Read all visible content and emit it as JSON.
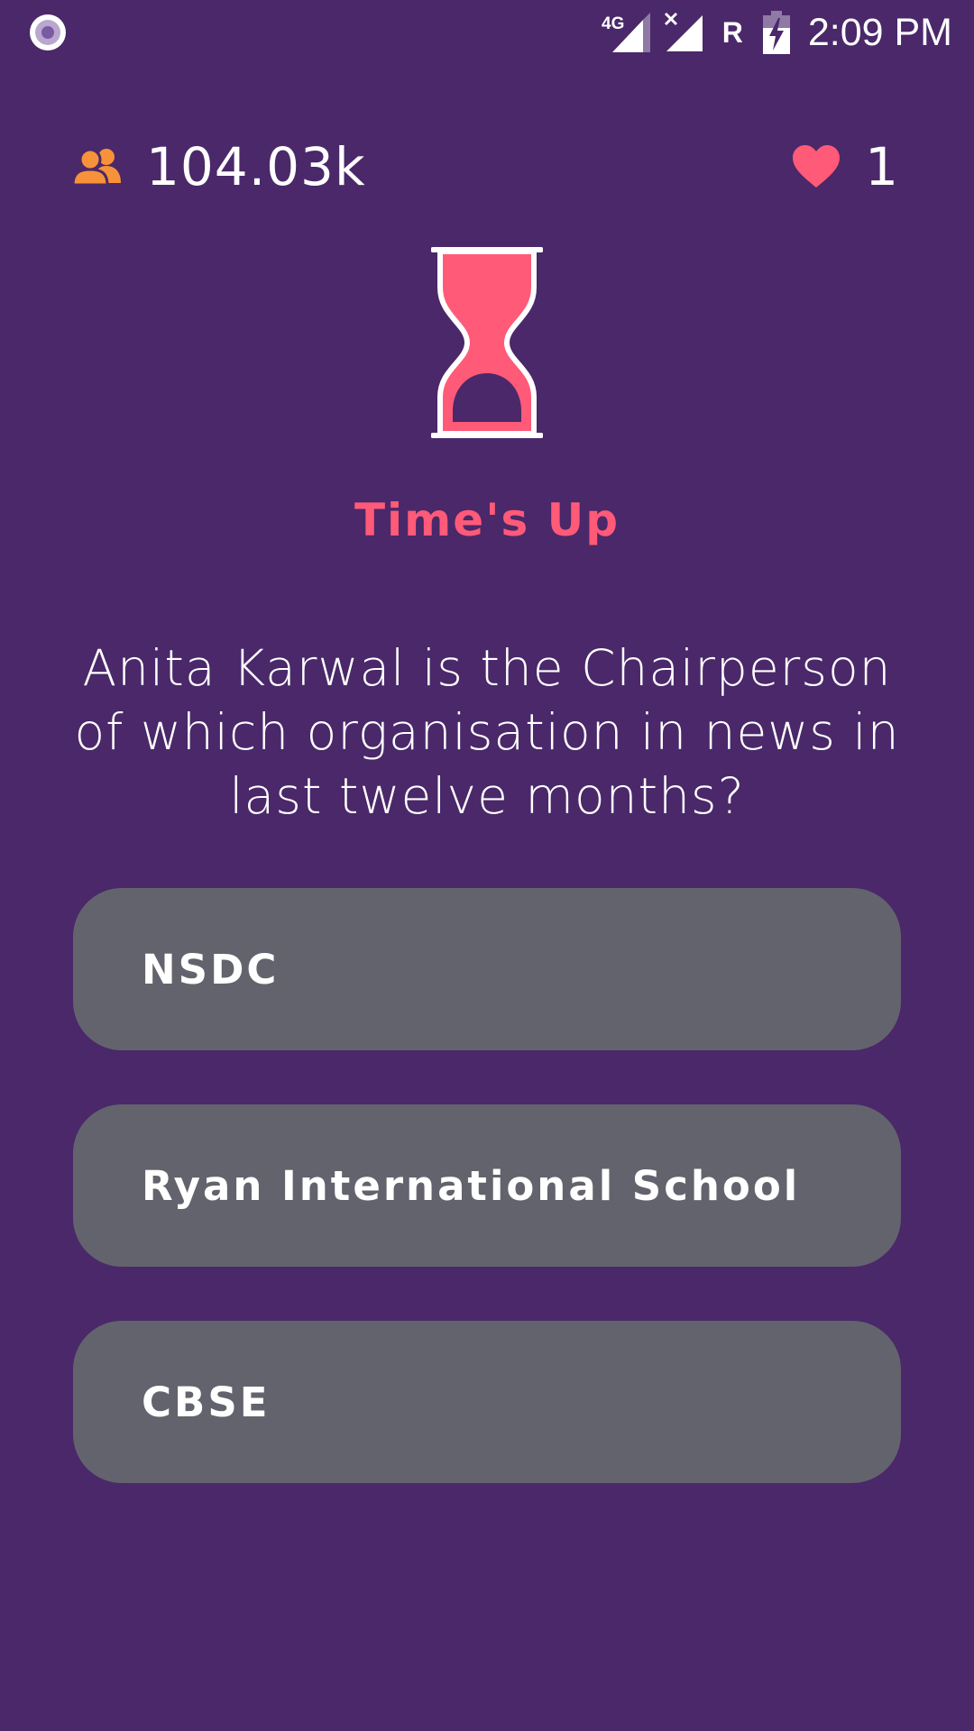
{
  "status_bar": {
    "network_type": "4G",
    "roaming_indicator": "R",
    "time": "2:09 PM",
    "icons": [
      "screen-record-icon",
      "signal-4g-icon",
      "signal-no-service-icon",
      "roaming-icon",
      "battery-charging-icon"
    ]
  },
  "header": {
    "players_count": "104.03k",
    "lives_count": "1",
    "players_icon": "people-icon",
    "lives_icon": "heart-icon"
  },
  "timer": {
    "icon": "hourglass-icon",
    "status_text": "Time's Up"
  },
  "question": {
    "text": "Anita Karwal is the Chairperson of which organisation in news in last twelve months?"
  },
  "options": [
    {
      "label": "NSDC"
    },
    {
      "label": "Ryan International School"
    },
    {
      "label": "CBSE"
    }
  ],
  "colors": {
    "background": "#4a2869",
    "accent": "#ff5a78",
    "players_icon": "#f7923a",
    "option_background": "#63636d",
    "text": "#ffffff"
  }
}
